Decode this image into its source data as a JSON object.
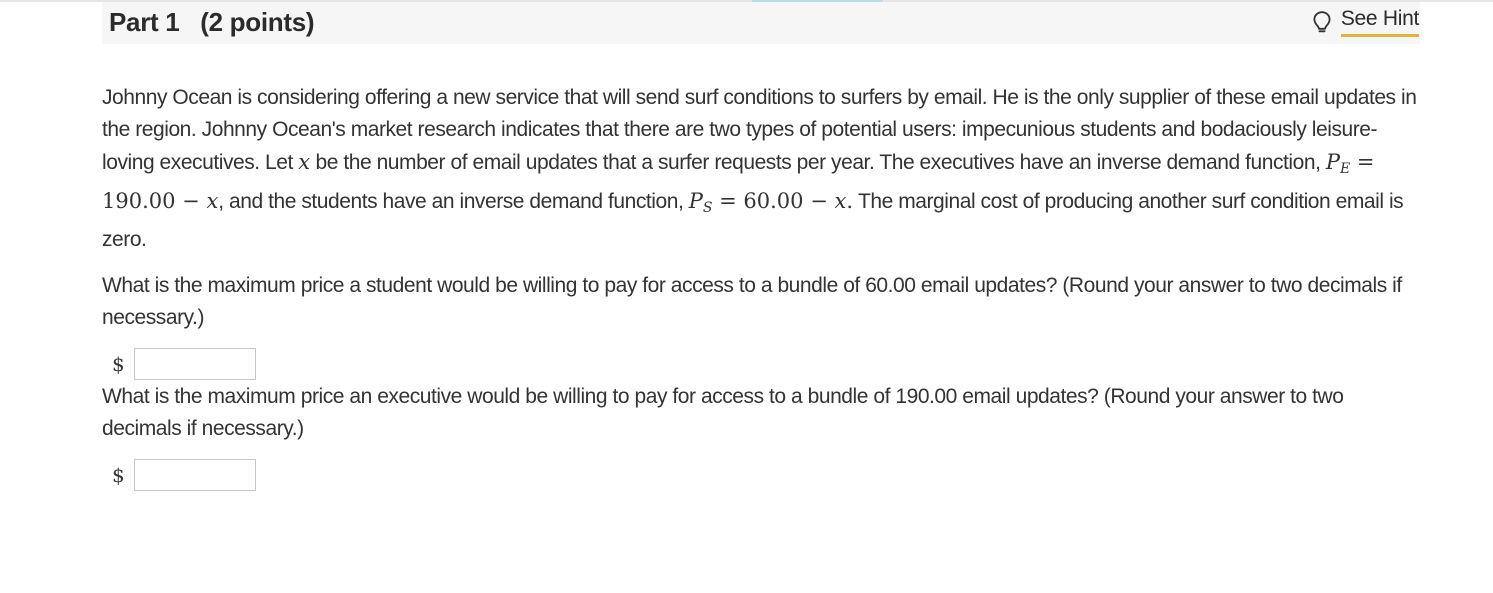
{
  "header": {
    "part_title": "Part 1   (2 points)",
    "hint_label": "See Hint",
    "hint_icon": "lightbulb-icon"
  },
  "problem": {
    "intro_1": "Johnny Ocean is considering offering a new service that will send surf conditions to surfers by email. He is the only supplier of these email updates in the region. Johnny Ocean's market research indicates that there are two types of potential users: impecunious students and bodaciously leisure-loving executives. Let ",
    "var_x": "x",
    "intro_2": " be the number of email updates that a surfer requests per year. The executives have an inverse demand function, ",
    "pe_symbol": "P",
    "pe_sub": "E",
    "pe_rhs": " = 190.00 − ",
    "intro_3": ", and the students have an inverse demand function, ",
    "ps_symbol": "P",
    "ps_sub": "S",
    "ps_rhs": " = 60.00 − ",
    "ps_end": ".",
    "intro_4": " The marginal cost of producing another surf condition email is zero."
  },
  "questions": [
    {
      "text": "What is the maximum price a student would be willing to pay for access to a bundle of 60.00 email updates? (Round your answer to two decimals if necessary.)",
      "currency": "$",
      "value": ""
    },
    {
      "text": "What is the maximum price an executive would be willing to pay for access to a bundle of 190.00 email updates? (Round your answer to two decimals if necessary.)",
      "currency": "$",
      "value": ""
    }
  ]
}
